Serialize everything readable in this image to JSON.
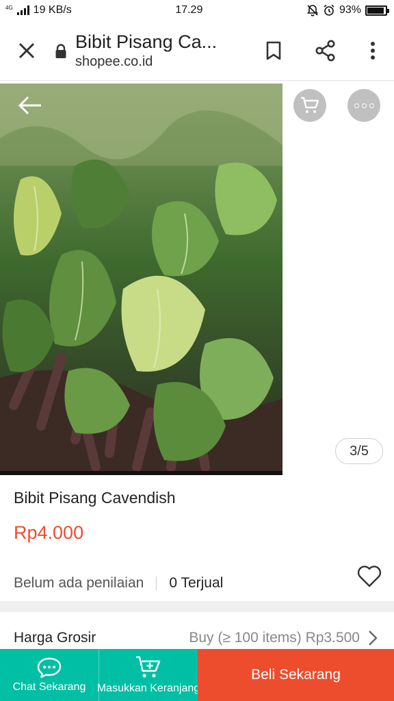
{
  "status_bar": {
    "network_tag": "4G",
    "speed": "19 KB/s",
    "time": "17.29",
    "battery": "93%",
    "battery_level": 0.93
  },
  "toolbar": {
    "title": "Bibit Pisang Ca...",
    "url": "shopee.co.id",
    "icons": [
      "close-icon",
      "lock-icon",
      "bookmark-icon",
      "share-icon",
      "more-vertical-icon"
    ]
  },
  "gallery": {
    "pager": "3/5",
    "icons": [
      "back-arrow-icon",
      "cart-icon",
      "more-horizontal-icon"
    ]
  },
  "product": {
    "name": "Bibit Pisang Cavendish",
    "price": "Rp4.000",
    "rating_text": "Belum ada penilaian",
    "sold_text": "0 Terjual"
  },
  "wholesale": {
    "label": "Harga Grosir",
    "value": "Buy (≥ 100 items) Rp3.500"
  },
  "bottom_bar": {
    "chat_label": "Chat Sekarang",
    "cart_label": "Masukkan Keranjang",
    "buy_label": "Beli Sekarang"
  },
  "colors": {
    "brand_orange": "#ee4d2d",
    "teal": "#00bfa5"
  }
}
